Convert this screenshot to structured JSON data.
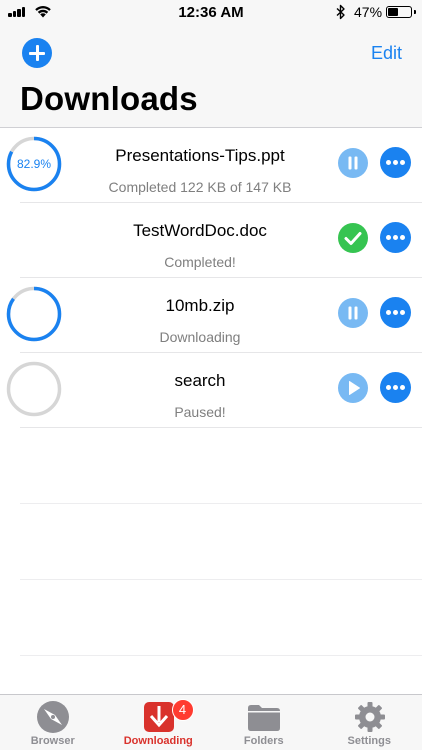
{
  "status_bar": {
    "time": "12:36 AM",
    "battery_percent": "47%",
    "battery_level": 0.47,
    "icons": [
      "cellular-signal-icon",
      "wifi-icon",
      "bluetooth-icon",
      "battery-icon"
    ]
  },
  "header": {
    "add_icon": "plus-circle-icon",
    "edit_label": "Edit",
    "title": "Downloads"
  },
  "downloads": [
    {
      "name": "Presentations-Tips.ppt",
      "status": "Completed 122 KB of 147 KB",
      "progress": 0.829,
      "progress_label": "82.9%",
      "state": "paused",
      "control_icon": "pause-icon"
    },
    {
      "name": "TestWordDoc.doc",
      "status": "Completed!",
      "progress": 1.0,
      "progress_label": "",
      "state": "completed",
      "control_icon": "checkmark-icon"
    },
    {
      "name": "10mb.zip",
      "status": "Downloading",
      "progress": 0.85,
      "progress_label": "",
      "state": "downloading",
      "control_icon": "pause-icon"
    },
    {
      "name": "search",
      "status": "Paused!",
      "progress": 0.0,
      "progress_label": "",
      "state": "paused",
      "control_icon": "play-icon"
    }
  ],
  "tab_bar": {
    "tabs": [
      {
        "label": "Browser",
        "icon": "compass-icon",
        "active": false
      },
      {
        "label": "Downloading",
        "icon": "download-icon",
        "active": true,
        "badge": "4"
      },
      {
        "label": "Folders",
        "icon": "folder-icon",
        "active": false
      },
      {
        "label": "Settings",
        "icon": "gear-icon",
        "active": false
      }
    ]
  },
  "colors": {
    "accent": "#1a82f0",
    "accent_light": "#78b9f3",
    "success": "#36c451",
    "active_tab": "#d9322c",
    "badge": "#ff3b30",
    "ring_track": "#d6d6d6"
  }
}
